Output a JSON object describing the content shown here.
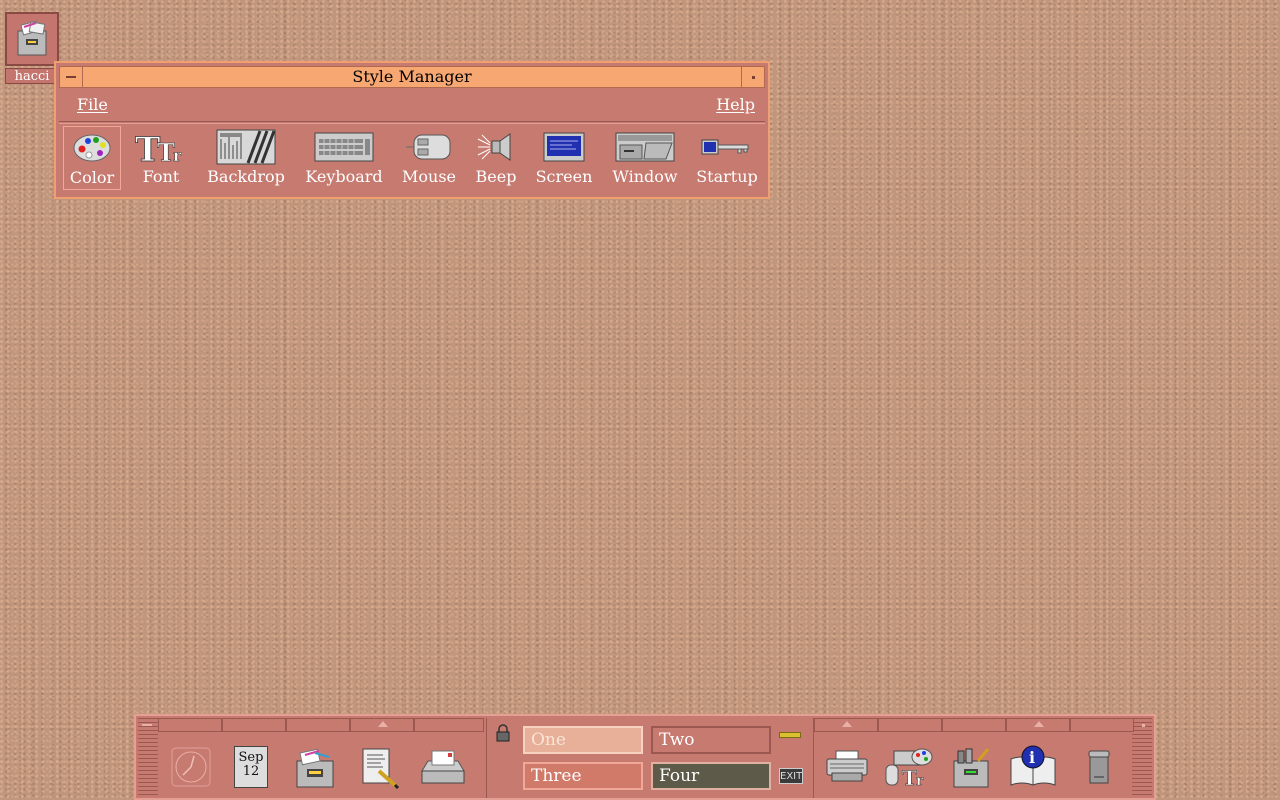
{
  "desktop": {
    "icon_label": "hacci"
  },
  "style_manager": {
    "title": "Style Manager",
    "menu": {
      "file": "File",
      "help": "Help"
    },
    "tools": [
      {
        "label": "Color",
        "icon": "palette-icon"
      },
      {
        "label": "Font",
        "icon": "font-icon"
      },
      {
        "label": "Backdrop",
        "icon": "backdrop-icon"
      },
      {
        "label": "Keyboard",
        "icon": "keyboard-icon"
      },
      {
        "label": "Mouse",
        "icon": "mouse-icon"
      },
      {
        "label": "Beep",
        "icon": "speaker-icon"
      },
      {
        "label": "Screen",
        "icon": "screen-icon"
      },
      {
        "label": "Window",
        "icon": "window-icon"
      },
      {
        "label": "Startup",
        "icon": "key-icon"
      }
    ]
  },
  "front_panel": {
    "calendar": {
      "month": "Sep",
      "day": "12"
    },
    "workspaces": [
      "One",
      "Two",
      "Three",
      "Four"
    ],
    "exit_label": "EXIT",
    "left_icons": [
      "clock-icon",
      "calendar-icon",
      "file-manager-icon",
      "text-editor-icon",
      "mail-icon"
    ],
    "right_icons": [
      "printer-icon",
      "style-manager-icon",
      "application-manager-icon",
      "help-icon",
      "trash-icon"
    ]
  },
  "colors": {
    "window_bg": "#c77a70",
    "titlebar": "#f7a772",
    "desktop": "#c0967c",
    "active_workspace": "#5e5a4a"
  }
}
